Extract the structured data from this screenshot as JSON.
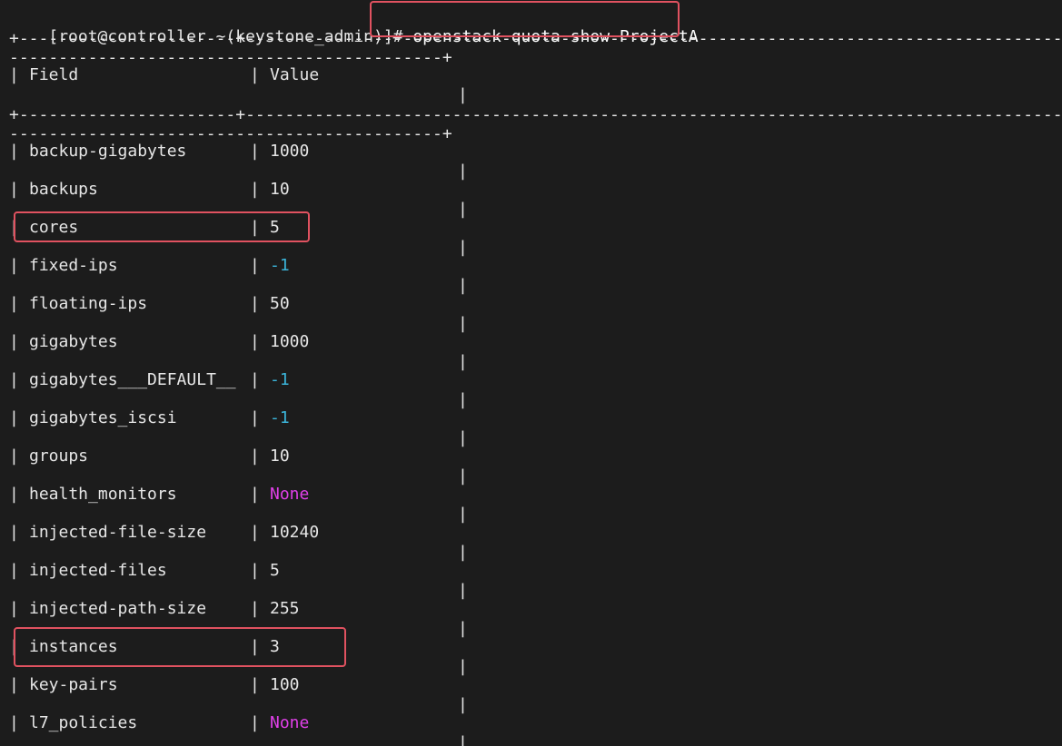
{
  "prompt": "[root@controller ~(keystone_admin)]#",
  "command": "openstack quota show ProjectA",
  "pipe": "|",
  "border_top": "+----------------------+----------------------------------------------------------------------------------------------------------------------------------------------------------------",
  "border_cont": "--------------------------------------------+",
  "header": {
    "field": "Field",
    "value": "Value"
  },
  "rows": [
    {
      "field": "backup-gigabytes",
      "value": "1000",
      "color": "#e6e6e6"
    },
    {
      "field": "backups",
      "value": "10",
      "color": "#e6e6e6"
    },
    {
      "field": "cores",
      "value": "5",
      "color": "#e6e6e6"
    },
    {
      "field": "fixed-ips",
      "value": "-1",
      "color": "#3bb4d9"
    },
    {
      "field": "floating-ips",
      "value": "50",
      "color": "#e6e6e6"
    },
    {
      "field": "gigabytes",
      "value": "1000",
      "color": "#e6e6e6"
    },
    {
      "field": "gigabytes___DEFAULT__",
      "value": "-1",
      "color": "#3bb4d9"
    },
    {
      "field": "gigabytes_iscsi",
      "value": "-1",
      "color": "#3bb4d9"
    },
    {
      "field": "groups",
      "value": "10",
      "color": "#e6e6e6"
    },
    {
      "field": "health_monitors",
      "value": "None",
      "color": "#e040e8"
    },
    {
      "field": "injected-file-size",
      "value": "10240",
      "color": "#e6e6e6"
    },
    {
      "field": "injected-files",
      "value": "5",
      "color": "#e6e6e6"
    },
    {
      "field": "injected-path-size",
      "value": "255",
      "color": "#e6e6e6"
    },
    {
      "field": "instances",
      "value": "3",
      "color": "#e6e6e6"
    },
    {
      "field": "key-pairs",
      "value": "100",
      "color": "#e6e6e6"
    },
    {
      "field": "l7_policies",
      "value": "None",
      "color": "#e040e8"
    }
  ],
  "colors": {
    "background": "#1c1c1c",
    "text": "#e6e6e6",
    "highlight_border": "#e05260",
    "numeric_negative": "#3bb4d9",
    "none_value": "#e040e8"
  }
}
